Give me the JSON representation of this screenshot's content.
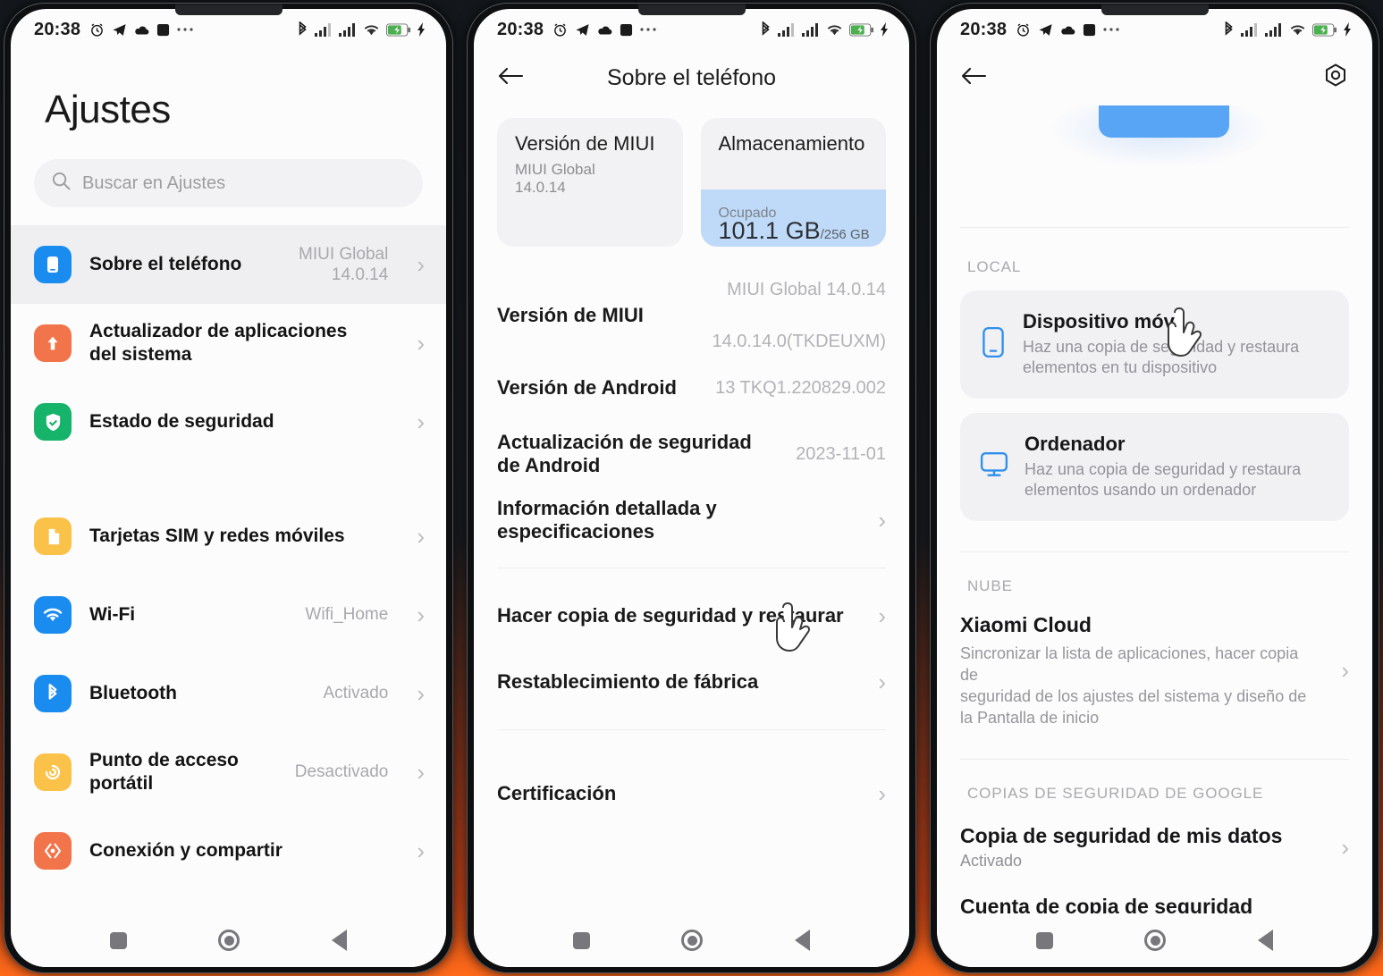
{
  "status_bar": {
    "time": "20:38",
    "left_icons": [
      "alarm-icon",
      "telegram-icon",
      "cloud-icon",
      "square-icon",
      "more-icon"
    ],
    "right_icons": [
      "bluetooth-icon",
      "signal-1-icon",
      "signal-2-icon",
      "wifi-icon",
      "battery-charging-icon",
      "charging-bolt-icon"
    ]
  },
  "nav_bar": {
    "recents_label": "recents",
    "home_label": "home",
    "back_label": "back"
  },
  "colors": {
    "accent_blue": "#2196f3",
    "icon_orange": "#f2744a",
    "icon_green": "#16b36b",
    "icon_yellow": "#fbc24a",
    "storage_fill": "#bfdaf8",
    "selected_row": "#efeff1"
  },
  "panel1": {
    "title": "Ajustes",
    "search": {
      "placeholder": "Buscar en Ajustes",
      "icon": "search-icon"
    },
    "items": [
      {
        "label": "Sobre el\nteléfono",
        "value": "MIUI Global\n14.0.14",
        "icon": "phone-icon",
        "icon_color": "#1a8cf0",
        "selected": true
      },
      {
        "label": "Actualizador de aplicaciones\ndel sistema",
        "value": "",
        "icon": "arrow-up-icon",
        "icon_color": "#f2744a",
        "selected": false
      },
      {
        "label": "Estado de seguridad",
        "value": "",
        "icon": "shield-check-icon",
        "icon_color": "#16b36b",
        "selected": false
      },
      {
        "label": "Tarjetas SIM y redes móviles",
        "value": "",
        "icon": "sim-card-icon",
        "icon_color": "#fbc24a",
        "selected": false
      },
      {
        "label": "Wi-Fi",
        "value": "Wifi_Home",
        "icon": "wifi-icon",
        "icon_color": "#1a8cf0",
        "selected": false
      },
      {
        "label": "Bluetooth",
        "value": "Activado",
        "icon": "bluetooth-icon",
        "icon_color": "#1a8cf0",
        "selected": false
      },
      {
        "label": "Punto de acceso\nportátil",
        "value": "Desactivado",
        "icon": "hotspot-icon",
        "icon_color": "#fbc24a",
        "selected": false
      },
      {
        "label": "Conexión y compartir",
        "value": "",
        "icon": "share-icon",
        "icon_color": "#f2744a",
        "selected": false
      }
    ]
  },
  "panel2": {
    "appbar": {
      "back": "back-arrow-icon",
      "title": "Sobre el teléfono"
    },
    "cards": {
      "miui": {
        "title": "Versión de MIUI",
        "sub": "MIUI Global\n14.0.14"
      },
      "storage": {
        "title": "Almacenamiento",
        "occupied_label": "Ocupado",
        "used": "101.1 GB",
        "total": "/256 GB"
      }
    },
    "info_rows": [
      {
        "label": "Versión de MIUI",
        "value": "MIUI Global 14.0.14\n\n14.0.14.0(TKDEUXM)",
        "chevron": false
      },
      {
        "label": "Versión de Android",
        "value": "13 TKQ1.220829.002",
        "chevron": false
      },
      {
        "label": "Actualización de seguridad\nde Android",
        "value": "2023-11-01",
        "chevron": false
      },
      {
        "label": "Información detallada y\nespecificaciones",
        "value": "",
        "chevron": true
      }
    ],
    "action_rows": [
      {
        "label": "Hacer copia de seguridad y restaurar",
        "chevron": true
      },
      {
        "label": "Restablecimiento de fábrica",
        "chevron": true
      }
    ],
    "cert_rows": [
      {
        "label": "Certificación",
        "chevron": true
      }
    ],
    "cursor_on": "Hacer copia de seguridad y restaurar"
  },
  "panel3": {
    "appbar": {
      "back": "back-arrow-icon",
      "settings": "gear-icon"
    },
    "sections": [
      {
        "label": "LOCAL"
      },
      {
        "label": "NUBE"
      },
      {
        "label": "COPIAS DE SEGURIDAD DE GOOGLE"
      }
    ],
    "local_cards": [
      {
        "title": "Dispositivo móvil",
        "desc": "Haz una copia de seguridad y restaura\nelementos en tu dispositivo",
        "icon": "mobile-device-icon"
      },
      {
        "title": "Ordenador",
        "desc": "Haz una copia de seguridad y restaura\nelementos usando un ordenador",
        "icon": "desktop-monitor-icon"
      }
    ],
    "cloud_rows": [
      {
        "title": "Xiaomi Cloud",
        "desc": "Sincronizar la lista de aplicaciones, hacer copia de\nseguridad de los ajustes del sistema y diseño de\nla Pantalla de inicio",
        "sub": "",
        "chevron": true
      }
    ],
    "google_rows": [
      {
        "title": "Copia de seguridad de mis datos",
        "sub": "Activado",
        "chevron": true
      },
      {
        "title": "Cuenta de copia de seguridad",
        "sub": "",
        "chevron": false
      }
    ],
    "cursor_on": "Dispositivo móvil"
  }
}
